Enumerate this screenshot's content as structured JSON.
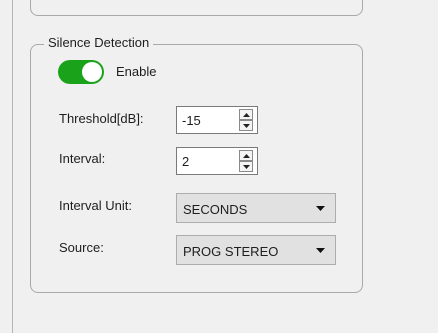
{
  "section": {
    "title": "Silence Detection",
    "enable": {
      "label": "Enable",
      "on": true
    }
  },
  "fields": {
    "threshold": {
      "label": "Threshold[dB]:",
      "value": "-15"
    },
    "interval": {
      "label": "Interval:",
      "value": "2"
    },
    "interval_unit": {
      "label": "Interval Unit:",
      "value": "SECONDS"
    },
    "source": {
      "label": "Source:",
      "value": "PROG STEREO"
    }
  },
  "colors": {
    "toggle_on": "#1aa31a",
    "border": "#a9a9a9",
    "background": "#f0f0f0"
  },
  "icons": {
    "spin_up": "triangle-up-icon",
    "spin_down": "triangle-down-icon",
    "dropdown": "chevron-down-icon"
  }
}
